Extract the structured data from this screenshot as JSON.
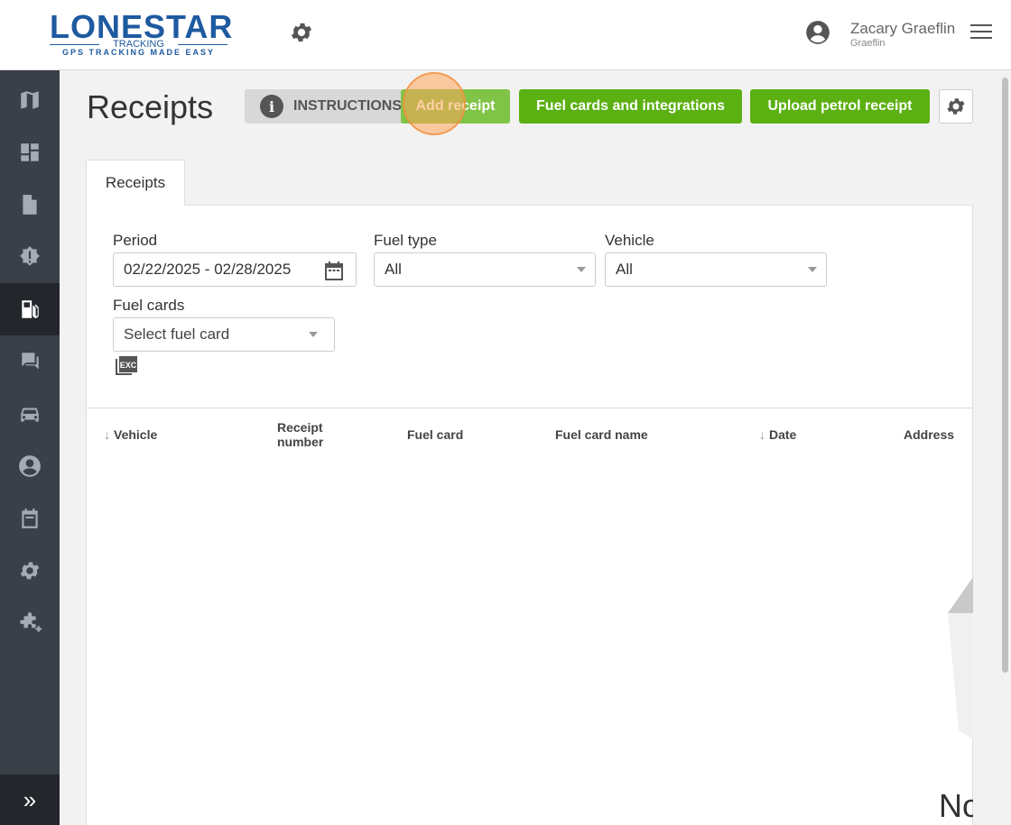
{
  "brand": {
    "logo_main": "LONESTAR",
    "logo_sub": "TRACKING",
    "logo_tagline": "GPS TRACKING MADE EASY",
    "accent": "#5bb012",
    "logo_color": "#1e5aa0"
  },
  "header": {
    "user_name": "Zacary Graeflin",
    "user_sub": "Graeflin"
  },
  "sidebar": {
    "items": [
      {
        "icon": "map-icon"
      },
      {
        "icon": "dashboard-icon"
      },
      {
        "icon": "document-icon"
      },
      {
        "icon": "alert-icon"
      },
      {
        "icon": "fuel-icon",
        "active": true
      },
      {
        "icon": "chat-icon"
      },
      {
        "icon": "car-icon"
      },
      {
        "icon": "user-icon"
      },
      {
        "icon": "calendar-icon"
      },
      {
        "icon": "gear-icon"
      },
      {
        "icon": "puzzle-icon"
      }
    ],
    "expand_label": "»"
  },
  "page": {
    "title": "Receipts",
    "buttons": {
      "instructions": "INSTRUCTIONS",
      "add_receipt": "Add receipt",
      "fuel_cards": "Fuel cards and integrations",
      "upload": "Upload petrol receipt"
    },
    "tab": "Receipts"
  },
  "filters": {
    "period_label": "Period",
    "period_value": "02/22/2025 - 02/28/2025",
    "fuel_type_label": "Fuel type",
    "fuel_type_value": "All",
    "vehicle_label": "Vehicle",
    "vehicle_value": "All",
    "fuel_cards_label": "Fuel cards",
    "fuel_cards_placeholder": "Select fuel card",
    "export_icon_text": "EXC"
  },
  "table": {
    "columns": [
      "Vehicle",
      "Receipt number",
      "Fuel card",
      "Fuel card name",
      "Date",
      "Address"
    ],
    "sortable": [
      "Vehicle",
      "Date"
    ]
  },
  "empty_state": {
    "text": "No"
  }
}
